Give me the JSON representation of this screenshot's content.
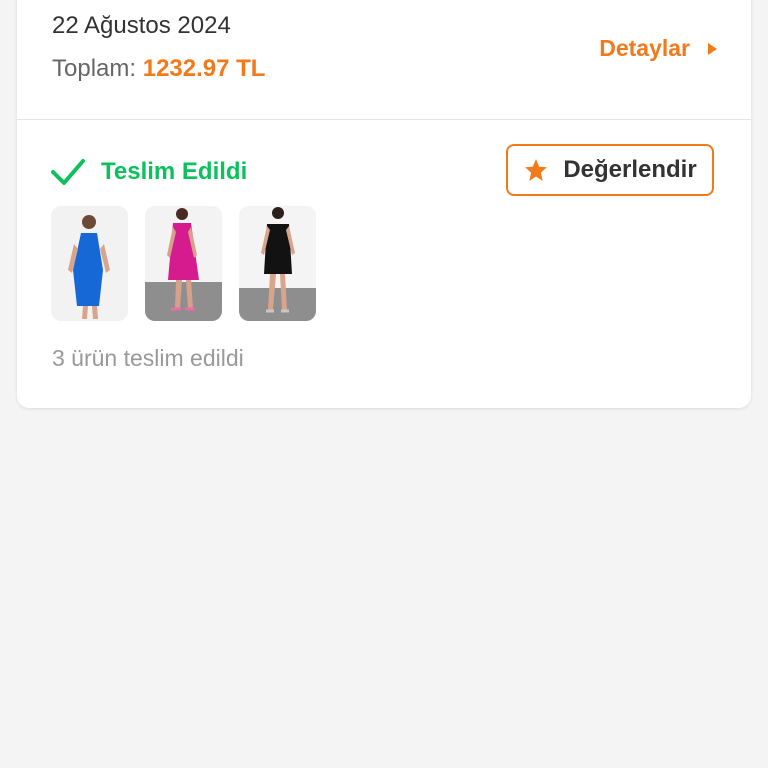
{
  "order": {
    "date": "22 Ağustos 2024",
    "total_label": "Toplam:",
    "total_value": "1232.97 TL",
    "details_label": "Detaylar",
    "details_icon": "caret-right-icon"
  },
  "shipment": {
    "status_label": "Teslim Edildi",
    "status_icon": "check-icon",
    "rate_button_label": "Değerlendir",
    "rate_icon": "star-icon",
    "products": [
      {
        "name": "blue-dress",
        "color": "#1668d6"
      },
      {
        "name": "pink-dress",
        "color": "#d61b8f"
      },
      {
        "name": "black-dress",
        "color": "#121212"
      }
    ],
    "delivery_note": "3 ürün teslim edildi"
  },
  "colors": {
    "accent": "#f27a1a",
    "success": "#0bc15c",
    "background": "#f4f4f4",
    "card": "#ffffff"
  }
}
